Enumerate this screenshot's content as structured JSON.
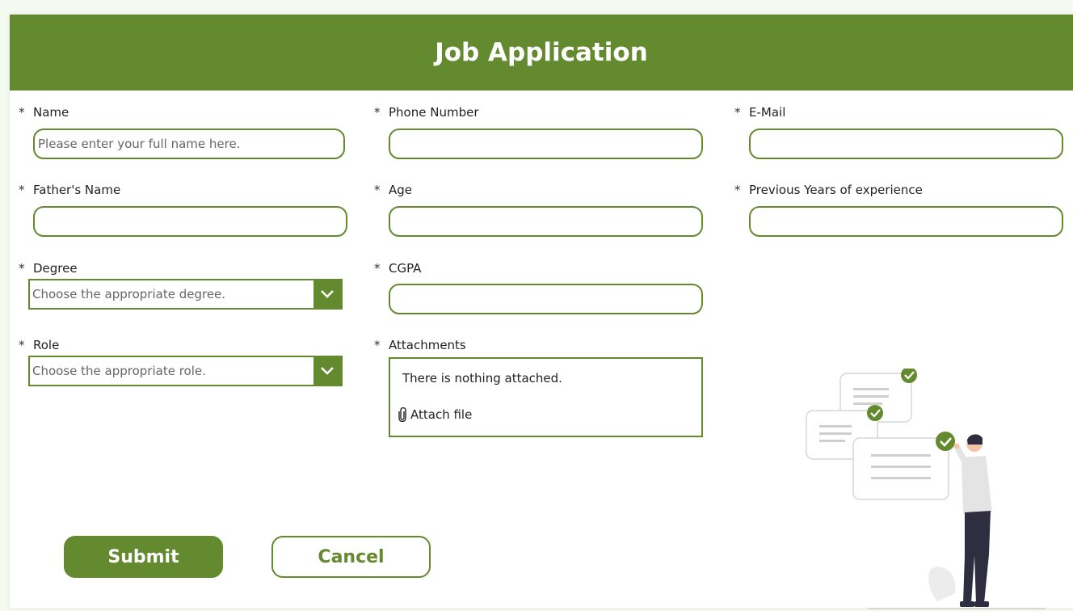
{
  "title": "Job Application",
  "required_marker": "*",
  "colors": {
    "accent": "#648a2f",
    "background": "#ffffff"
  },
  "fields": {
    "name": {
      "label": "Name",
      "placeholder": "Please enter your full name here.",
      "value": ""
    },
    "phone": {
      "label": "Phone Number",
      "value": ""
    },
    "email": {
      "label": "E-Mail",
      "value": ""
    },
    "father_name": {
      "label": "Father's Name",
      "value": ""
    },
    "age": {
      "label": "Age",
      "value": ""
    },
    "experience": {
      "label": "Previous Years of experience",
      "value": ""
    },
    "degree": {
      "label": "Degree",
      "selected": "Choose the appropriate degree.",
      "icon": "chevron-down-icon"
    },
    "cgpa": {
      "label": "CGPA",
      "value": ""
    },
    "role": {
      "label": "Role",
      "selected": "Choose the appropriate role.",
      "icon": "chevron-down-icon"
    },
    "attachments": {
      "label": "Attachments",
      "empty_message": "There is nothing attached.",
      "attach_label": "Attach file",
      "icon": "paperclip-icon"
    }
  },
  "buttons": {
    "submit": "Submit",
    "cancel": "Cancel"
  }
}
